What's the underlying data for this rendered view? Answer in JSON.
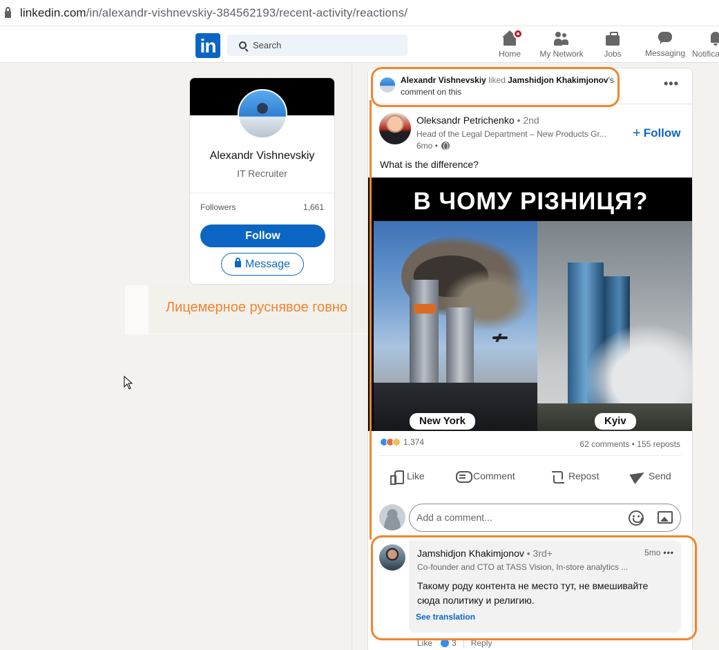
{
  "browser": {
    "url_host": "linkedin.com",
    "url_path": "/in/alexandr-vishnevskiy-384562193/recent-activity/reactions/"
  },
  "nav": {
    "logo": "in",
    "search_placeholder": "Search",
    "items": [
      {
        "label": "Home",
        "icon": "home-icon"
      },
      {
        "label": "My Network",
        "icon": "network-icon"
      },
      {
        "label": "Jobs",
        "icon": "briefcase-icon"
      },
      {
        "label": "Messaging",
        "icon": "messaging-icon"
      },
      {
        "label": "Notificat",
        "icon": "bell-icon"
      }
    ],
    "accent_color": "#0a66c2"
  },
  "profile": {
    "name": "Alexandr Vishnevskiy",
    "title": "IT Recruiter",
    "followers_label": "Followers",
    "followers_count": "1,661",
    "follow_button": "Follow",
    "message_button": "Message"
  },
  "overlay_annotation": {
    "text": "Лицемерное руснявое говно",
    "color": "#f08430"
  },
  "feed": {
    "context": {
      "actor": "Alexandr Vishnevskiy",
      "verb": "liked",
      "target": "Jamshidjon Khakimjonov",
      "suffix": "'s",
      "line2": "comment on this"
    },
    "more_menu": "•••",
    "post": {
      "author": "Oleksandr Petrichenko",
      "degree": "• 2nd",
      "headline": "Head of the Legal Department – New Products Gr...",
      "time": "6mo •",
      "follow": "Follow",
      "text": "What is the difference?",
      "image": {
        "banner": "В ЧОМУ РІЗНИЦЯ?",
        "left_label": "New York",
        "right_label": "Kyiv"
      },
      "reactions_count": "1,374",
      "stats": "62 comments • 155 reposts",
      "actions": [
        "Like",
        "Comment",
        "Repost",
        "Send"
      ],
      "comment_placeholder": "Add a comment..."
    },
    "comment": {
      "author": "Jamshidjon Khakimjonov",
      "degree": "• 3rd+",
      "time": "5mo",
      "headline": "Co-founder and CTO at TASS Vision, In-store analytics ...",
      "text": "Такому роду контента не место тут, не вмешивайте сюда политику и религию.",
      "see_translation": "See translation",
      "like_label": "Like",
      "like_count": "3",
      "reply_label": "Reply"
    }
  },
  "annotation_color": "#f0852d"
}
